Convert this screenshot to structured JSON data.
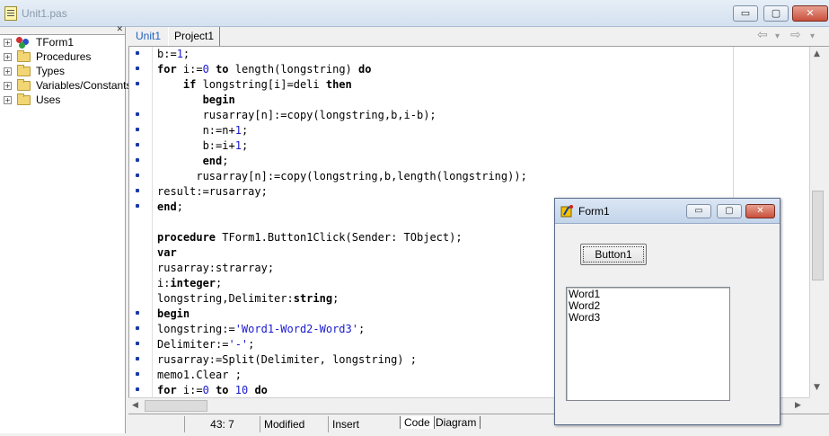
{
  "window": {
    "title": "Unit1.pas",
    "min_glyph": "▭",
    "max_glyph": "▢",
    "close_glyph": "✕"
  },
  "tree": {
    "close_glyph": "✕",
    "items": [
      {
        "label": "TForm1",
        "icon": "class-icon",
        "expander": "+"
      },
      {
        "label": "Procedures",
        "icon": "folder-icon",
        "expander": "+"
      },
      {
        "label": "Types",
        "icon": "folder-icon",
        "expander": "+"
      },
      {
        "label": "Variables/Constants",
        "icon": "folder-icon",
        "expander": "+"
      },
      {
        "label": "Uses",
        "icon": "folder-icon",
        "expander": "+"
      }
    ]
  },
  "tabs": {
    "items": [
      {
        "label": "Unit1"
      },
      {
        "label": "Project1"
      }
    ],
    "back_glyph": "⇦",
    "forward_glyph": "⇨",
    "dropdown_glyph": "▾"
  },
  "editor": {
    "lines": [
      {
        "dot": true,
        "text": "b:=1;"
      },
      {
        "dot": true,
        "text": "for i:=0 to length(longstring) do"
      },
      {
        "dot": true,
        "text": "    if longstring[i]=deli then"
      },
      {
        "dot": false,
        "text": "       begin"
      },
      {
        "dot": true,
        "text": "       rusarray[n]:=copy(longstring,b,i-b);"
      },
      {
        "dot": true,
        "text": "       n:=n+1;"
      },
      {
        "dot": true,
        "text": "       b:=i+1;"
      },
      {
        "dot": true,
        "text": "       end;"
      },
      {
        "dot": true,
        "text": "      rusarray[n]:=copy(longstring,b,length(longstring));"
      },
      {
        "dot": true,
        "text": "result:=rusarray;"
      },
      {
        "dot": true,
        "text": "end;"
      },
      {
        "dot": false,
        "text": ""
      },
      {
        "dot": false,
        "text": "procedure TForm1.Button1Click(Sender: TObject);"
      },
      {
        "dot": false,
        "text": "var"
      },
      {
        "dot": false,
        "text": "rusarray:strarray;"
      },
      {
        "dot": false,
        "text": "i:integer;"
      },
      {
        "dot": false,
        "text": "longstring,Delimiter:string;"
      },
      {
        "dot": true,
        "text": "begin"
      },
      {
        "dot": true,
        "text": "longstring:='Word1-Word2-Word3';"
      },
      {
        "dot": true,
        "text": "Delimiter:='-';"
      },
      {
        "dot": true,
        "text": "rusarray:=Split(Delimiter, longstring) ;"
      },
      {
        "dot": true,
        "text": "memo1.Clear ;"
      },
      {
        "dot": true,
        "text": "for i:=0 to 10 do"
      }
    ]
  },
  "statusbar": {
    "position": "43:  7",
    "modified": "Modified",
    "mode": "Insert",
    "bottom_tabs": [
      "Code",
      "Diagram"
    ]
  },
  "form1": {
    "title": "Form1",
    "min_glyph": "▭",
    "max_glyph": "▢",
    "close_glyph": "✕",
    "button_label": "Button1",
    "memo_lines": [
      "Word1",
      "Word2",
      "Word3"
    ]
  },
  "colors": {
    "keyword": "#000000",
    "number": "#1a1ad0",
    "string": "#1a1ad0",
    "active_tab": "#2060c0",
    "gutter_dot": "#1a3aa8"
  }
}
